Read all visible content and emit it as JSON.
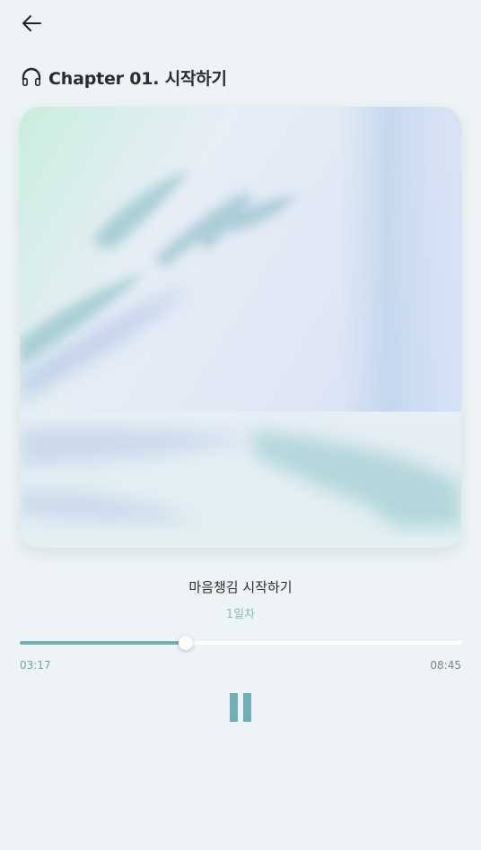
{
  "header": {
    "back_icon": "arrow-left-icon",
    "title_icon": "headphones-icon",
    "title": "Chapter 01. 시작하기"
  },
  "cover": {
    "description_icon": "cover-artwork"
  },
  "track": {
    "title": "마음챙김 시작하기",
    "subtitle": "1일차"
  },
  "player": {
    "elapsed": "03:17",
    "total": "08:45",
    "progress_fraction": 0.375,
    "state": "playing",
    "pause_icon": "pause-icon"
  },
  "colors": {
    "accent": "#6fb0b5",
    "background": "#eef4f5",
    "subtitle": "#86b9bd"
  }
}
